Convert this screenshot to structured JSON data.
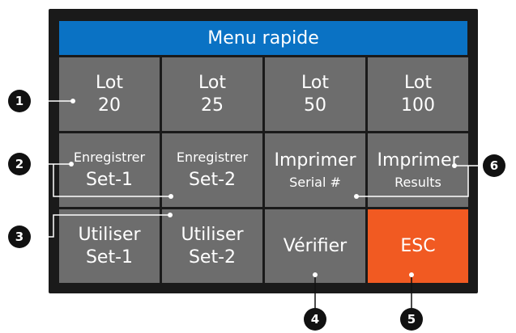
{
  "title": "Menu rapide",
  "buttons": {
    "lot20": {
      "line1": "Lot",
      "line2": "20"
    },
    "lot25": {
      "line1": "Lot",
      "line2": "25"
    },
    "lot50": {
      "line1": "Lot",
      "line2": "50"
    },
    "lot100": {
      "line1": "Lot",
      "line2": "100"
    },
    "save1": {
      "line1": "Enregistrer",
      "line2": "Set-1"
    },
    "save2": {
      "line1": "Enregistrer",
      "line2": "Set-2"
    },
    "printSerial": {
      "line1": "Imprimer",
      "line2": "Serial #"
    },
    "printResults": {
      "line1": "Imprimer",
      "line2": "Results"
    },
    "use1": {
      "line1": "Utiliser",
      "line2": "Set-1"
    },
    "use2": {
      "line1": "Utiliser",
      "line2": "Set-2"
    },
    "verify": {
      "label": "Vérifier"
    },
    "esc": {
      "label": "ESC"
    }
  },
  "callouts": [
    "1",
    "2",
    "3",
    "4",
    "5",
    "6"
  ],
  "colors": {
    "title_bar": "#0a72c4",
    "button": "#6d6d6d",
    "esc": "#f15a22",
    "bezel": "#1a1a1a",
    "callout": "#111111"
  }
}
